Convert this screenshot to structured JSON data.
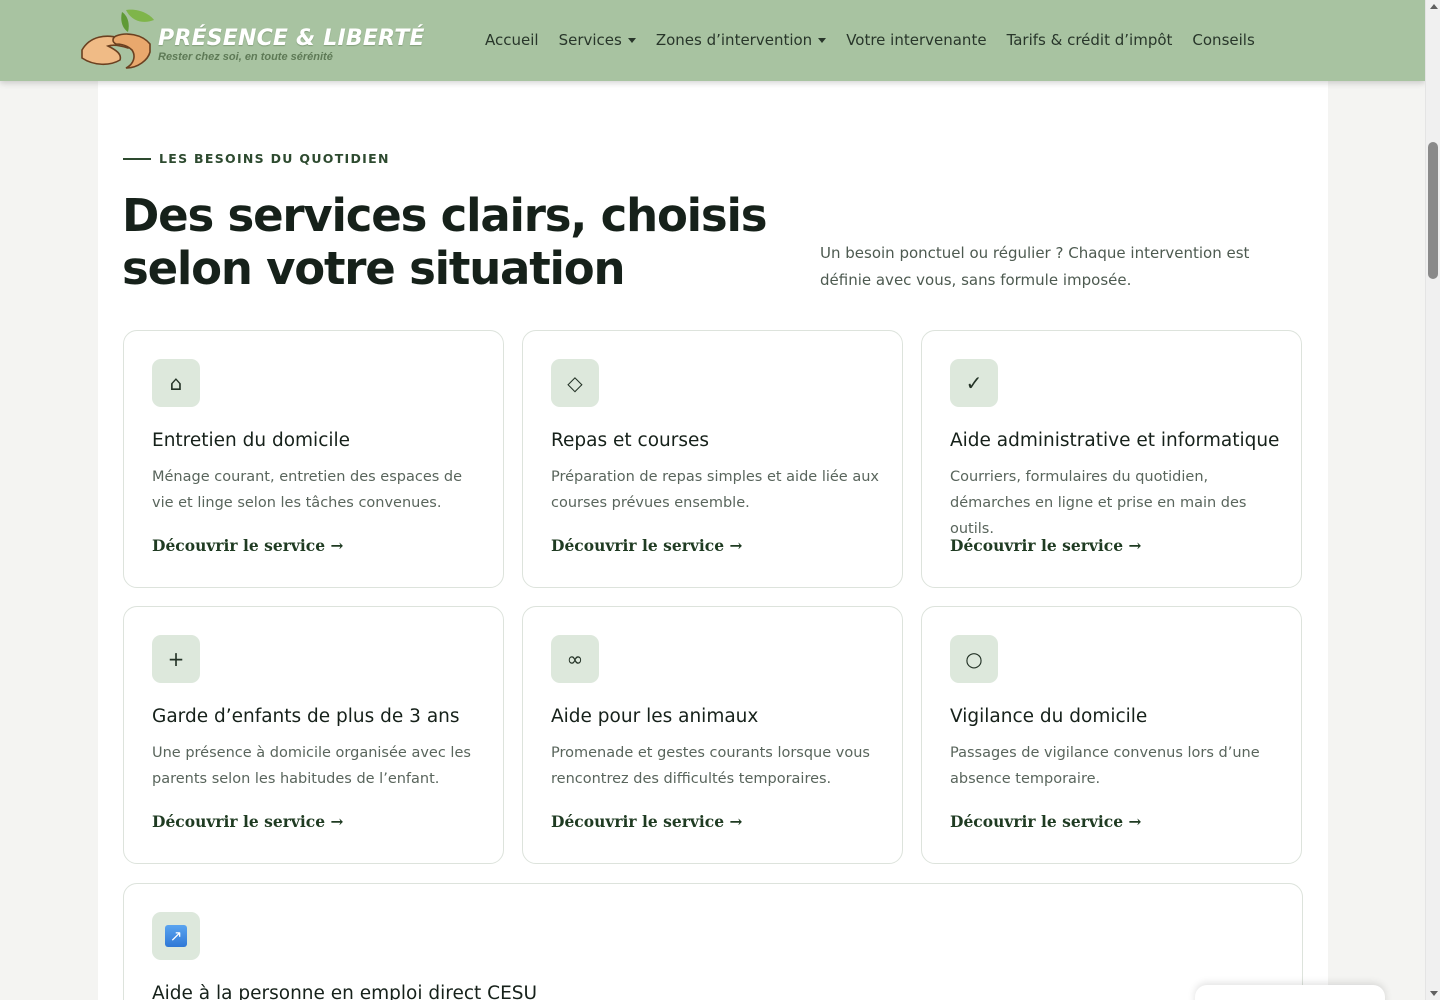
{
  "header": {
    "logo_title": "PRÉSENCE & LIBERTÉ",
    "logo_tagline": "Rester chez soi, en toute sérénité",
    "nav": [
      {
        "label": "Accueil",
        "dropdown": false
      },
      {
        "label": "Services",
        "dropdown": true
      },
      {
        "label": "Zones d’intervention",
        "dropdown": true
      },
      {
        "label": "Votre intervenante",
        "dropdown": false
      },
      {
        "label": "Tarifs & crédit d’impôt",
        "dropdown": false
      },
      {
        "label": "Conseils",
        "dropdown": false
      }
    ]
  },
  "section": {
    "eyebrow": "LES BESOINS DU QUOTIDIEN",
    "heading": "Des services clairs, choisis selon votre situation",
    "intro": "Un besoin ponctuel ou régulier ? Chaque intervention est définie avec vous, sans formule imposée."
  },
  "cards": [
    {
      "icon": "⌂",
      "icon_name": "home-icon",
      "title": "Entretien du domicile",
      "description": "Ménage courant, entretien des espaces de vie et linge selon les tâches convenues.",
      "link": "Découvrir le service →"
    },
    {
      "icon": "◇",
      "icon_name": "diamond-icon",
      "title": "Repas et courses",
      "description": "Préparation de repas simples et aide liée aux courses prévues ensemble.",
      "link": "Découvrir le service →"
    },
    {
      "icon": "✓",
      "icon_name": "check-icon",
      "title": "Aide administrative et informatique",
      "description": "Courriers, formulaires du quotidien, démarches en ligne et prise en main des outils.",
      "link": "Découvrir le service →"
    },
    {
      "icon": "+",
      "icon_name": "plus-icon",
      "title": "Garde d’enfants de plus de 3 ans",
      "description": "Une présence à domicile organisée avec les parents selon les habitudes de l’enfant.",
      "link": "Découvrir le service →"
    },
    {
      "icon": "∞",
      "icon_name": "infinity-icon",
      "title": "Aide pour les animaux",
      "description": "Promenade et gestes courants lorsque vous rencontrez des difficultés temporaires.",
      "link": "Découvrir le service →"
    },
    {
      "icon": "○",
      "icon_name": "circle-icon",
      "title": "Vigilance du domicile",
      "description": "Passages de vigilance convenus lors d’une absence temporaire.",
      "link": "Découvrir le service →"
    }
  ],
  "wide_card": {
    "icon": "↗",
    "icon_name": "arrow-up-right-icon",
    "title": "Aide à la personne en emploi direct CESU"
  },
  "colors": {
    "header_bg": "#a8c3a1",
    "accent_dark": "#1f3b22",
    "icon_bg": "#dde8dc"
  }
}
